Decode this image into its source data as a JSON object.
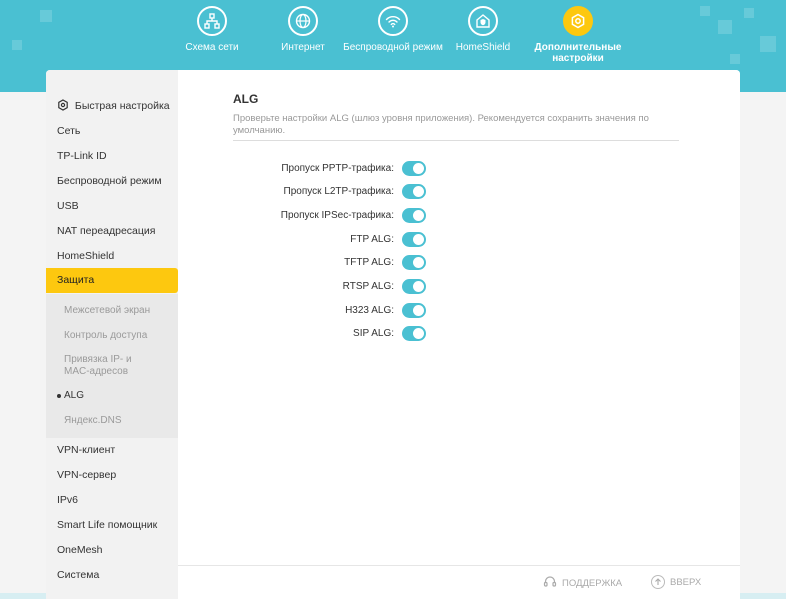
{
  "colors": {
    "accent": "#4ac0d2",
    "active": "#fdc80f"
  },
  "topnav": [
    {
      "label": "Схема сети",
      "icon": "network-map-icon"
    },
    {
      "label": "Интернет",
      "icon": "globe-icon"
    },
    {
      "label": "Беспроводной режим",
      "icon": "wifi-icon"
    },
    {
      "label": "HomeShield",
      "icon": "home-shield-icon"
    },
    {
      "label": "Дополнительные настройки",
      "icon": "gear-icon",
      "active": true
    }
  ],
  "sidebar": {
    "quick_setup": "Быстрая настройка",
    "items": [
      "Сеть",
      "TP-Link ID",
      "Беспроводной режим",
      "USB",
      "NAT переадресация",
      "HomeShield",
      "Защита",
      "VPN-клиент",
      "VPN-сервер",
      "IPv6",
      "Smart Life помощник",
      "OneMesh",
      "Система"
    ],
    "sub_items": [
      "Межсетевой экран",
      "Контроль доступа",
      "Привязка IP- и MAC-адресов",
      "ALG",
      "Яндекс.DNS"
    ]
  },
  "main": {
    "title": "ALG",
    "description": "Проверьте настройки ALG (шлюз уровня приложения). Рекомендуется сохранить значения по умолчанию.",
    "settings": [
      {
        "label": "Пропуск PPTP-трафика:",
        "enabled": true
      },
      {
        "label": "Пропуск L2TP-трафика:",
        "enabled": true
      },
      {
        "label": "Пропуск IPSec-трафика:",
        "enabled": true
      },
      {
        "label": "FTP ALG:",
        "enabled": true
      },
      {
        "label": "TFTP ALG:",
        "enabled": true
      },
      {
        "label": "RTSP ALG:",
        "enabled": true
      },
      {
        "label": "H323 ALG:",
        "enabled": true
      },
      {
        "label": "SIP ALG:",
        "enabled": true
      }
    ]
  },
  "footer": {
    "support": "ПОДДЕРЖКА",
    "top": "ВВЕРХ"
  }
}
